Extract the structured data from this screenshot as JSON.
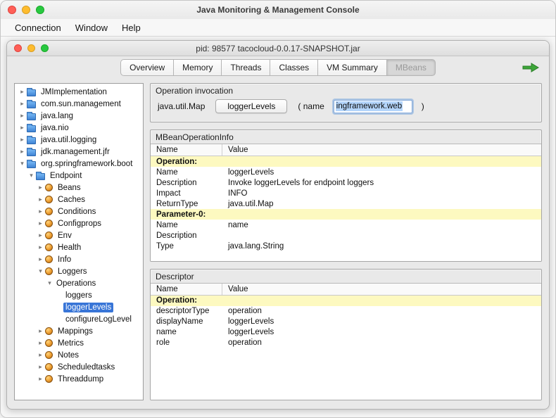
{
  "colors": {
    "selection_blue": "#3875d7",
    "row_highlight": "#fdf9c0",
    "text_selection": "#b4d5fb",
    "connected_green": "#3da639"
  },
  "window": {
    "title": "Java Monitoring & Management Console",
    "menu_items": [
      "Connection",
      "Window",
      "Help"
    ]
  },
  "inner_window": {
    "title": "pid: 98577 tacocloud-0.0.17-SNAPSHOT.jar"
  },
  "tabs": [
    {
      "label": "Overview",
      "active": false
    },
    {
      "label": "Memory",
      "active": false
    },
    {
      "label": "Threads",
      "active": false
    },
    {
      "label": "Classes",
      "active": false
    },
    {
      "label": "VM Summary",
      "active": false
    },
    {
      "label": "MBeans",
      "active": true
    }
  ],
  "tree": {
    "items": [
      {
        "label": "JMImplementation",
        "level": 0,
        "state": "collapsed",
        "icon": "folder",
        "selected": false
      },
      {
        "label": "com.sun.management",
        "level": 0,
        "state": "collapsed",
        "icon": "folder",
        "selected": false
      },
      {
        "label": "java.lang",
        "level": 0,
        "state": "collapsed",
        "icon": "folder",
        "selected": false
      },
      {
        "label": "java.nio",
        "level": 0,
        "state": "collapsed",
        "icon": "folder",
        "selected": false
      },
      {
        "label": "java.util.logging",
        "level": 0,
        "state": "collapsed",
        "icon": "folder",
        "selected": false
      },
      {
        "label": "jdk.management.jfr",
        "level": 0,
        "state": "collapsed",
        "icon": "folder",
        "selected": false
      },
      {
        "label": "org.springframework.boot",
        "level": 0,
        "state": "expanded",
        "icon": "folder",
        "selected": false
      },
      {
        "label": "Endpoint",
        "level": 1,
        "state": "expanded",
        "icon": "folder",
        "selected": false
      },
      {
        "label": "Beans",
        "level": 2,
        "state": "collapsed",
        "icon": "bean",
        "selected": false
      },
      {
        "label": "Caches",
        "level": 2,
        "state": "collapsed",
        "icon": "bean",
        "selected": false
      },
      {
        "label": "Conditions",
        "level": 2,
        "state": "collapsed",
        "icon": "bean",
        "selected": false
      },
      {
        "label": "Configprops",
        "level": 2,
        "state": "collapsed",
        "icon": "bean",
        "selected": false
      },
      {
        "label": "Env",
        "level": 2,
        "state": "collapsed",
        "icon": "bean",
        "selected": false
      },
      {
        "label": "Health",
        "level": 2,
        "state": "collapsed",
        "icon": "bean",
        "selected": false
      },
      {
        "label": "Info",
        "level": 2,
        "state": "collapsed",
        "icon": "bean",
        "selected": false
      },
      {
        "label": "Loggers",
        "level": 2,
        "state": "expanded",
        "icon": "bean",
        "selected": false
      },
      {
        "label": "Operations",
        "level": 3,
        "state": "expanded",
        "icon": "none",
        "selected": false
      },
      {
        "label": "loggers",
        "level": 4,
        "state": "leaf",
        "icon": "none",
        "selected": false
      },
      {
        "label": "loggerLevels",
        "level": 4,
        "state": "leaf",
        "icon": "none",
        "selected": true
      },
      {
        "label": "configureLogLevel",
        "level": 4,
        "state": "leaf",
        "icon": "none",
        "selected": false
      },
      {
        "label": "Mappings",
        "level": 2,
        "state": "collapsed",
        "icon": "bean",
        "selected": false
      },
      {
        "label": "Metrics",
        "level": 2,
        "state": "collapsed",
        "icon": "bean",
        "selected": false
      },
      {
        "label": "Notes",
        "level": 2,
        "state": "collapsed",
        "icon": "bean",
        "selected": false
      },
      {
        "label": "Scheduledtasks",
        "level": 2,
        "state": "collapsed",
        "icon": "bean",
        "selected": false
      },
      {
        "label": "Threaddump",
        "level": 2,
        "state": "collapsed",
        "icon": "bean",
        "selected": false
      }
    ]
  },
  "operation_invocation": {
    "title": "Operation invocation",
    "return_type": "java.util.Map",
    "button_label": "loggerLevels",
    "paren_open": "( name",
    "field_value": "ingframework.web",
    "paren_close": ")"
  },
  "mbean_operation_info": {
    "title": "MBeanOperationInfo",
    "columns": [
      "Name",
      "Value"
    ],
    "rows": [
      {
        "name": "Operation:",
        "value": "",
        "highlight": true
      },
      {
        "name": "Name",
        "value": "loggerLevels",
        "highlight": false
      },
      {
        "name": "Description",
        "value": "Invoke loggerLevels for endpoint loggers",
        "highlight": false
      },
      {
        "name": "Impact",
        "value": "INFO",
        "highlight": false
      },
      {
        "name": "ReturnType",
        "value": "java.util.Map",
        "highlight": false
      },
      {
        "name": "Parameter-0:",
        "value": "",
        "highlight": true
      },
      {
        "name": "Name",
        "value": "name",
        "highlight": false
      },
      {
        "name": "Description",
        "value": "",
        "highlight": false
      },
      {
        "name": "Type",
        "value": "java.lang.String",
        "highlight": false
      }
    ]
  },
  "descriptor": {
    "title": "Descriptor",
    "columns": [
      "Name",
      "Value"
    ],
    "rows": [
      {
        "name": "Operation:",
        "value": "",
        "highlight": true
      },
      {
        "name": "descriptorType",
        "value": "operation",
        "highlight": false
      },
      {
        "name": "displayName",
        "value": "loggerLevels",
        "highlight": false
      },
      {
        "name": "name",
        "value": "loggerLevels",
        "highlight": false
      },
      {
        "name": "role",
        "value": "operation",
        "highlight": false
      }
    ]
  }
}
